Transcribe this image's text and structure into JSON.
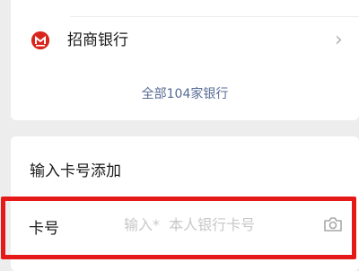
{
  "bank_list": {
    "items": [
      {
        "name": "招商银行",
        "logo_icon": "cmb-logo-icon",
        "logo_color": "#d9251c"
      }
    ],
    "all_banks_link": "全部104家银行"
  },
  "add_by_number": {
    "title": "输入卡号添加",
    "card_label": "卡号",
    "card_input_placeholder": "输入*  本人银行卡号",
    "card_input_value": "",
    "scan_icon": "camera-icon"
  },
  "colors": {
    "background": "#ededed",
    "card": "#ffffff",
    "link": "#576b95",
    "highlight": "#e61919"
  }
}
